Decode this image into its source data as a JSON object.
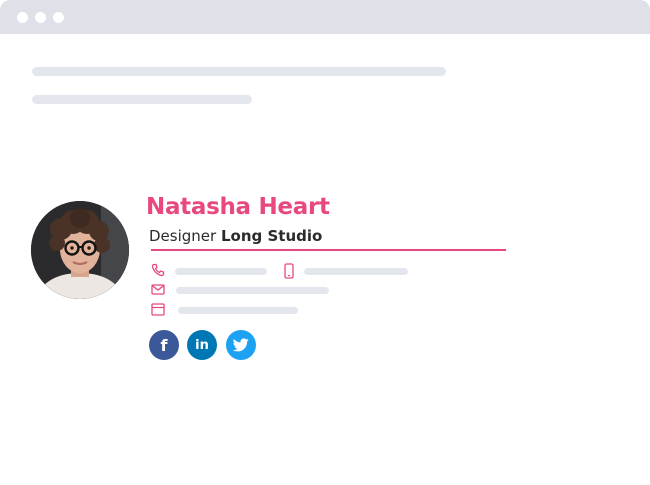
{
  "signature": {
    "name": "Natasha Heart",
    "role": "Designer",
    "company": "Long Studio"
  },
  "contacts": {
    "phone_icon": "phone-icon",
    "mobile_icon": "mobile-phone-icon",
    "email_icon": "envelope-icon",
    "website_icon": "browser-window-icon"
  },
  "social": {
    "facebook": {
      "glyph": "f",
      "color": "#3b5998"
    },
    "linkedin": {
      "glyph": "in",
      "color": "#0077b5"
    },
    "twitter": {
      "color": "#1da1f2"
    }
  },
  "colors": {
    "accent": "#e8487f",
    "titlebar": "#dfe1e8",
    "placeholder": "#e3e6ed"
  }
}
